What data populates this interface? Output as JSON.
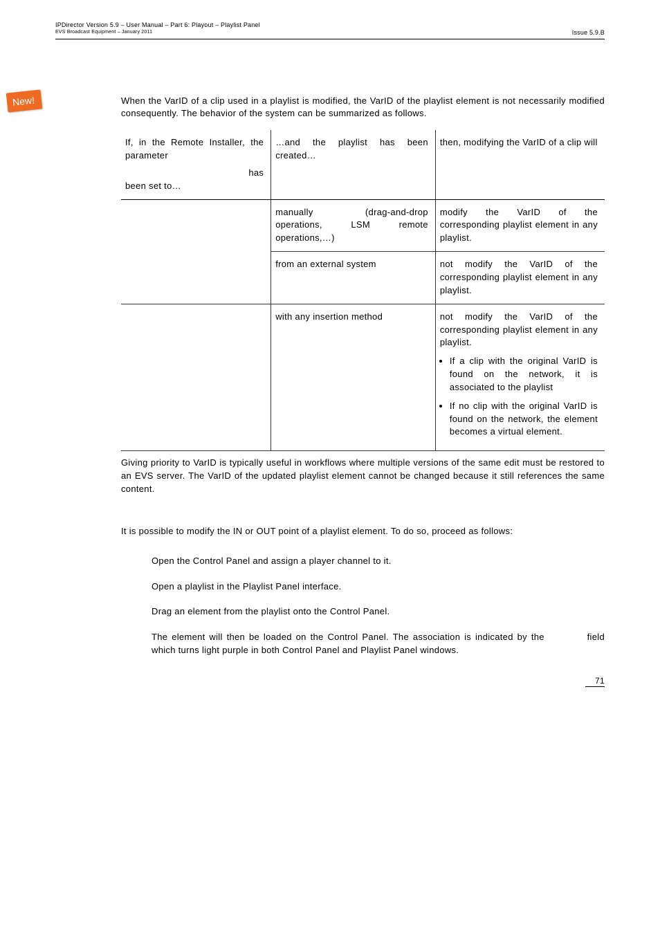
{
  "header": {
    "line1": "IPDirector Version 5.9 – User Manual – Part 6: Playout – Playlist Panel",
    "line2": "EVS Broadcast Equipment – January 2011",
    "issue": "Issue 5.9.B"
  },
  "tag": "New!",
  "intro": "When the VarID of a clip used in a playlist is modified, the VarID of the playlist element is not necessarily modified consequently. The behavior of the system can be summarized as follows.",
  "table": {
    "head": {
      "c1a": "If, in the Remote Installer, the parameter",
      "c1b": "has",
      "c1c": "been set to…",
      "c2": "…and the playlist has been created…",
      "c3": "then, modifying the VarID of a clip will"
    },
    "r1": {
      "c2": "manually (drag-and-drop operations, LSM remote operations,…)",
      "c3": "modify the VarID of the corresponding playlist element in any playlist."
    },
    "r2": {
      "c2": "from an external system",
      "c3": "not modify the VarID of the corresponding playlist element in any playlist."
    },
    "r3": {
      "c2": "with any insertion method",
      "c3": "not modify the VarID of the corresponding playlist element in any playlist.",
      "b1": "If a clip with the original VarID is found on the network, it is associated to the playlist",
      "b2": "If no clip with the original VarID is found on the network, the element becomes a virtual element."
    }
  },
  "afterTable": "Giving priority to VarID is typically useful in workflows where multiple versions of the same edit must be restored to an EVS server.  The VarID of the updated playlist element cannot be changed because it still references the same content.",
  "section2Intro": "It is possible to modify the IN or OUT point of a playlist element. To do so, proceed as follows:",
  "steps": {
    "s1": "Open the Control Panel and assign a player channel to it.",
    "s2": "Open a playlist in the Playlist Panel interface.",
    "s3": "Drag an element from the playlist onto the Control Panel.",
    "s4a": "The element will then be loaded on the Control Panel. The association is indicated by the",
    "s4b": "field which turns light purple in both Control Panel and Playlist Panel windows."
  },
  "pageNumber": "71"
}
